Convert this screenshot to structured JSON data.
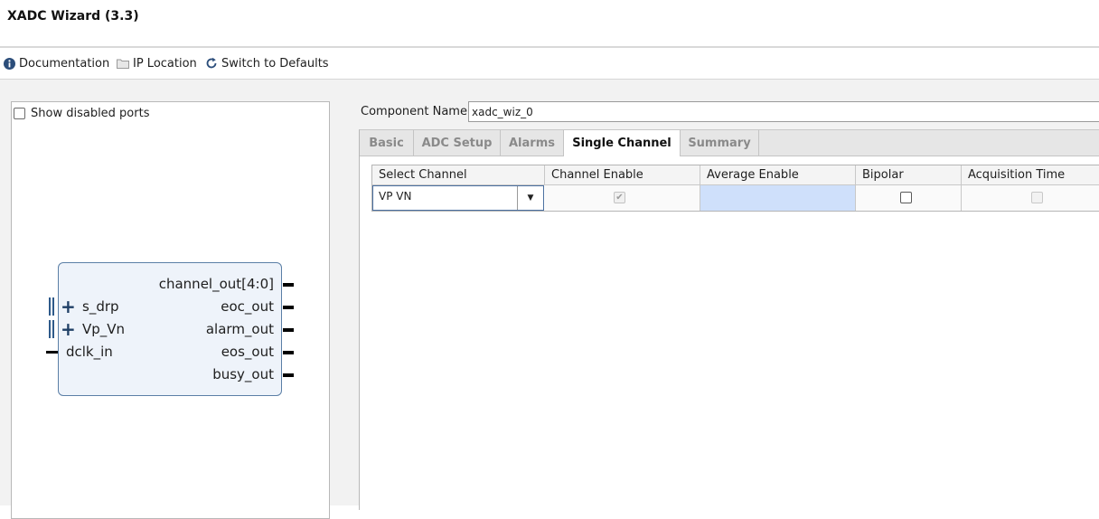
{
  "window": {
    "title": "XADC Wizard (3.3)"
  },
  "toolbar": {
    "documentation": {
      "label": "Documentation",
      "icon": "info-icon"
    },
    "ip_location": {
      "label": "IP Location",
      "icon": "folder-icon"
    },
    "switch_defaults": {
      "label": "Switch to Defaults",
      "icon": "refresh-icon"
    }
  },
  "left_panel": {
    "show_disabled_ports": {
      "label": "Show disabled ports",
      "checked": false
    },
    "block": {
      "outputs": [
        "channel_out[4:0]",
        "eoc_out",
        "alarm_out",
        "eos_out",
        "busy_out"
      ],
      "inputs": [
        "s_drp",
        "Vp_Vn",
        "dclk_in"
      ]
    }
  },
  "component": {
    "label": "Component Name",
    "value": "xadc_wiz_0"
  },
  "tabs": [
    {
      "label": "Basic",
      "active": false
    },
    {
      "label": "ADC Setup",
      "active": false
    },
    {
      "label": "Alarms",
      "active": false
    },
    {
      "label": "Single Channel",
      "active": true
    },
    {
      "label": "Summary",
      "active": false
    }
  ],
  "table": {
    "headers": [
      "Select Channel",
      "Channel Enable",
      "Average Enable",
      "Bipolar",
      "Acquisition Time"
    ],
    "row": {
      "select_channel": "VP VN",
      "channel_enable": true,
      "average_enable": "",
      "bipolar": false,
      "acquisition_time": false
    }
  },
  "colors": {
    "accent": "#2e5a8a",
    "block_fill": "#eef3fa",
    "selected_cell": "#cfe0fb"
  }
}
